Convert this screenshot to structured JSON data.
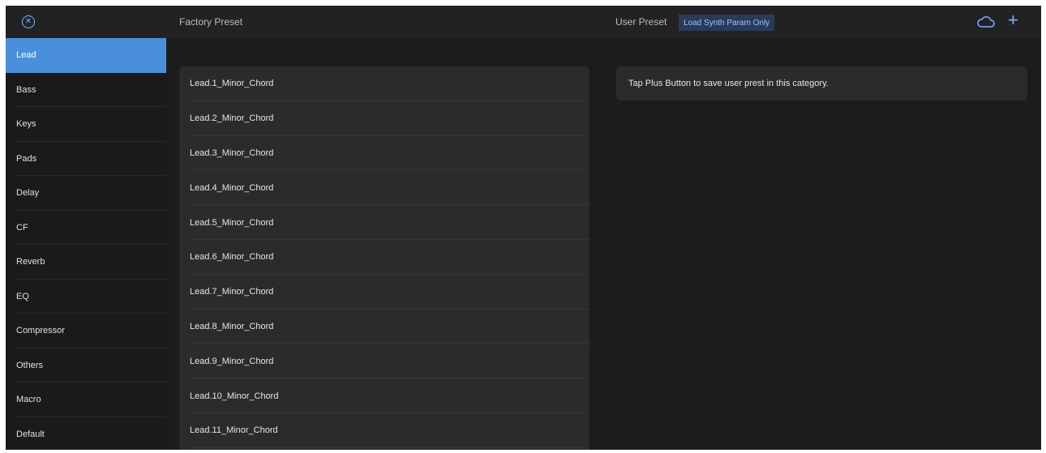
{
  "header": {
    "close_icon": "close-circle-icon",
    "factory_label": "Factory Preset",
    "user_label": "User Preset",
    "load_toggle_label": "Load Synth Param Only",
    "cloud_icon": "cloud-icon",
    "plus_symbol": "+",
    "accent_color": "#7fb2ff"
  },
  "sidebar": {
    "selected_color": "#4a8fd9",
    "items": [
      {
        "label": "Lead"
      },
      {
        "label": "Bass"
      },
      {
        "label": "Keys"
      },
      {
        "label": "Pads"
      },
      {
        "label": "Delay"
      },
      {
        "label": "CF"
      },
      {
        "label": "Reverb"
      },
      {
        "label": "EQ"
      },
      {
        "label": "Compressor"
      },
      {
        "label": "Others"
      },
      {
        "label": "Macro"
      },
      {
        "label": "Default"
      }
    ]
  },
  "factory_presets": [
    "Lead.1_Minor_Chord",
    "Lead.2_Minor_Chord",
    "Lead.3_Minor_Chord",
    "Lead.4_Minor_Chord",
    "Lead.5_Minor_Chord",
    "Lead.6_Minor_Chord",
    "Lead.7_Minor_Chord",
    "Lead.8_Minor_Chord",
    "Lead.9_Minor_Chord",
    "Lead.10_Minor_Chord",
    "Lead.11_Minor_Chord"
  ],
  "user_presets": {
    "empty_message": "Tap Plus Button to save user prest in this category."
  }
}
